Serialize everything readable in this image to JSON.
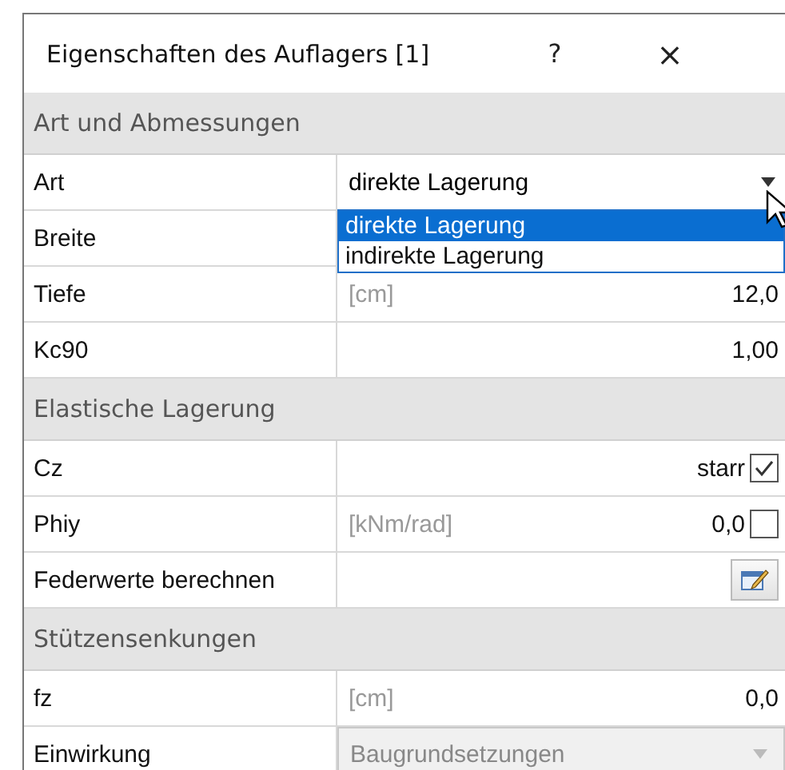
{
  "dialog": {
    "title": "Eigenschaften des Auflagers [1]",
    "help": "?",
    "close": "×"
  },
  "sections": [
    {
      "title": "Art und Abmessungen",
      "rows": [
        {
          "kind": "combo",
          "label": "Art",
          "value": "direkte Lagerung",
          "open": true,
          "disabled": false,
          "options": [
            {
              "label": "direkte Lagerung",
              "selected": true
            },
            {
              "label": "indirekte Lagerung",
              "selected": false
            }
          ]
        },
        {
          "kind": "value",
          "label": "Breite"
        },
        {
          "kind": "value",
          "label": "Tiefe",
          "unit": "[cm]",
          "value": "12,0"
        },
        {
          "kind": "value",
          "label": "Kc90",
          "value": "1,00"
        }
      ]
    },
    {
      "title": "Elastische Lagerung",
      "rows": [
        {
          "kind": "check",
          "label": "Cz",
          "value": "starr",
          "checked": true
        },
        {
          "kind": "check",
          "label": "Phiy",
          "unit": "[kNm/rad]",
          "value": "0,0",
          "checked": false
        },
        {
          "kind": "button",
          "label": "Federwerte berechnen"
        }
      ]
    },
    {
      "title": "Stützensenkungen",
      "rows": [
        {
          "kind": "value",
          "label": "fz",
          "unit": "[cm]",
          "value": "0,0"
        },
        {
          "kind": "combo",
          "label": "Einwirkung",
          "value": "Baugrundsetzungen",
          "open": false,
          "disabled": true
        }
      ]
    }
  ]
}
